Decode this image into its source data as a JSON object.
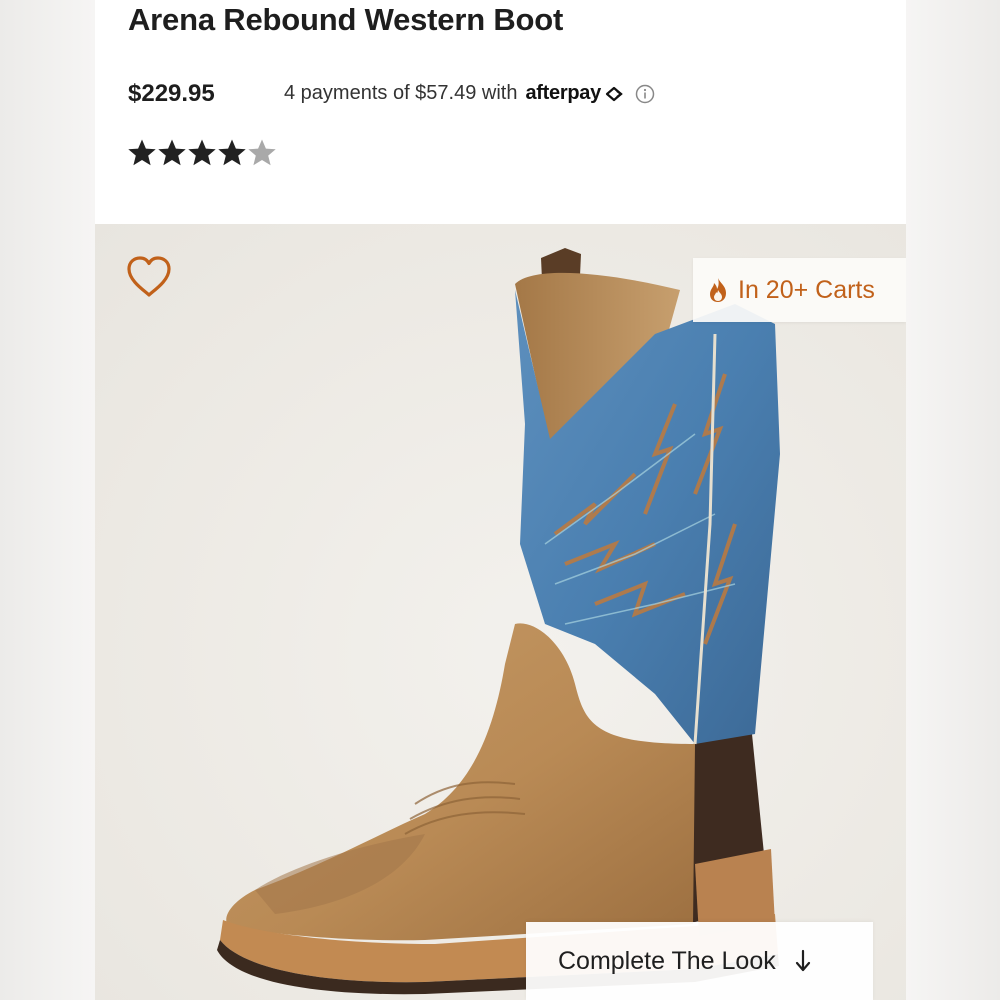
{
  "product": {
    "title": "Arena Rebound Western Boot",
    "price": "$229.95",
    "installments_text": "4 payments of $57.49 with",
    "afterpay_brand": "afterpay",
    "rating_stars": 4,
    "rating_max": 5
  },
  "gallery": {
    "badge_text": "In 20+ Carts",
    "complete_look_label": "Complete The Look"
  },
  "icons": {
    "favorite": "heart-outline-icon",
    "badge": "flame-icon",
    "info": "info-circle-icon",
    "arrow": "arrow-down-icon"
  },
  "colors": {
    "accent_orange": "#c1611a",
    "star_filled": "#222222",
    "star_empty": "#a9a9a9"
  }
}
